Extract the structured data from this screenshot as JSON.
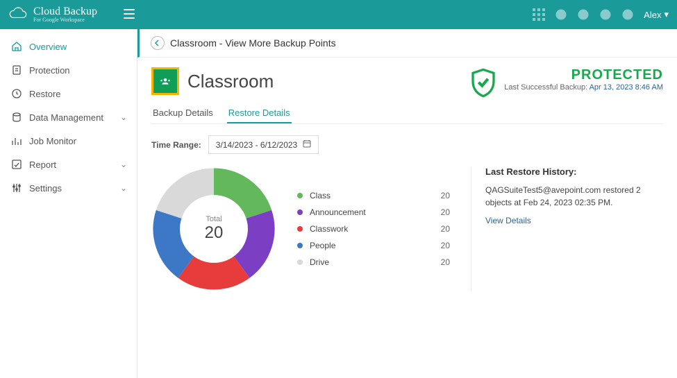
{
  "brand": {
    "name": "Cloud Backup",
    "tagline": "For Google Workspace"
  },
  "topbar": {
    "user": "Alex"
  },
  "sidebar": {
    "items": [
      {
        "label": "Overview",
        "icon": "home-icon",
        "active": true
      },
      {
        "label": "Protection",
        "icon": "shield-doc-icon"
      },
      {
        "label": "Restore",
        "icon": "history-icon"
      },
      {
        "label": "Data Management",
        "icon": "database-icon",
        "expandable": true
      },
      {
        "label": "Job Monitor",
        "icon": "chart-icon"
      },
      {
        "label": "Report",
        "icon": "report-icon",
        "expandable": true
      },
      {
        "label": "Settings",
        "icon": "sliders-icon",
        "expandable": true
      }
    ]
  },
  "breadcrumb": "Classroom - View More Backup Points",
  "page": {
    "title": "Classroom",
    "status_label": "PROTECTED",
    "last_backup_prefix": "Last Successful Backup:",
    "last_backup_time": "Apr 13, 2023 8:46 AM"
  },
  "tabs": [
    {
      "label": "Backup Details",
      "active": false
    },
    {
      "label": "Restore Details",
      "active": true
    }
  ],
  "time_range": {
    "label": "Time Range:",
    "value": "3/14/2023 - 6/12/2023"
  },
  "chart_data": {
    "type": "pie",
    "title": "",
    "center_label": "Total",
    "center_value": 20,
    "series": [
      {
        "name": "Class",
        "value": 20,
        "color": "#62b85a"
      },
      {
        "name": "Announcement",
        "value": 20,
        "color": "#7c3fc4"
      },
      {
        "name": "Classwork",
        "value": 20,
        "color": "#e63c3c"
      },
      {
        "name": "People",
        "value": 20,
        "color": "#3d78c7"
      },
      {
        "name": "Drive",
        "value": 20,
        "color": "#d9d9d9"
      }
    ]
  },
  "restore_history": {
    "heading": "Last Restore History:",
    "text": "QAGSuiteTest5@avepoint.com restored 2 objects at Feb 24, 2023 02:35 PM.",
    "link": "View Details"
  }
}
